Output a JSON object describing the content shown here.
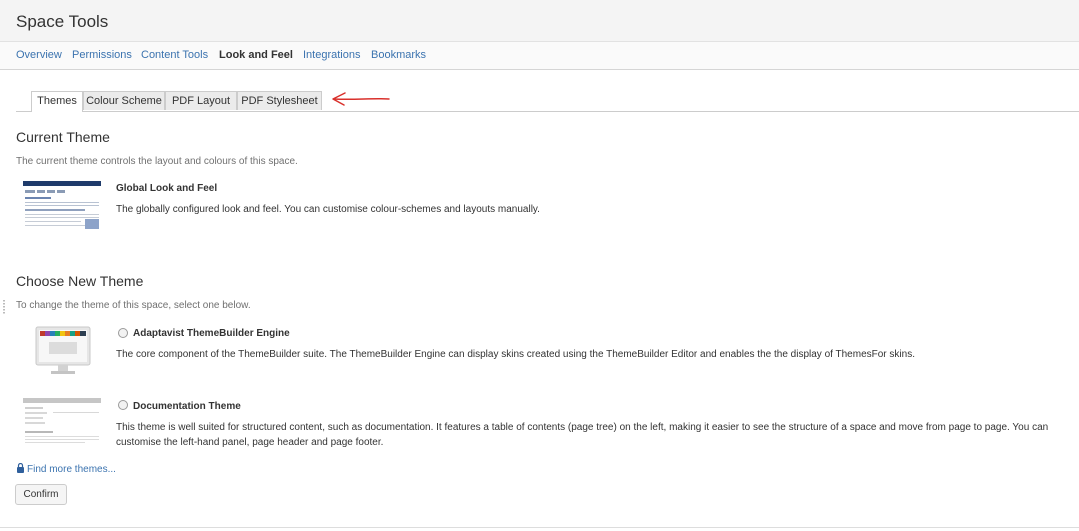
{
  "header": {
    "title": "Space Tools"
  },
  "nav": {
    "items": [
      {
        "label": "Overview"
      },
      {
        "label": "Permissions"
      },
      {
        "label": "Content Tools"
      },
      {
        "label": "Look and Feel",
        "active": true
      },
      {
        "label": "Integrations"
      },
      {
        "label": "Bookmarks"
      }
    ]
  },
  "subtabs": [
    {
      "label": "Themes",
      "active": true
    },
    {
      "label": "Colour Scheme"
    },
    {
      "label": "PDF Layout"
    },
    {
      "label": "PDF Stylesheet"
    }
  ],
  "current": {
    "heading": "Current Theme",
    "description": "The current theme controls the layout and colours of this space.",
    "theme_name": "Global Look and Feel",
    "theme_desc": "The globally configured look and feel. You can customise colour-schemes and layouts manually."
  },
  "choose": {
    "heading": "Choose New Theme",
    "description": "To change the theme of this space, select one below.",
    "themes": [
      {
        "name": "Adaptavist ThemeBuilder Engine",
        "desc": "The core component of the ThemeBuilder suite. The ThemeBuilder Engine can display skins created using the ThemeBuilder Editor and enables the the display of ThemesFor skins."
      },
      {
        "name": "Documentation Theme",
        "desc": "This theme is well suited for structured content, such as documentation. It features a table of contents (page tree) on the left, making it easier to see the structure of a space and move from page to page. You can customise the left-hand panel, page header and page footer."
      }
    ]
  },
  "find_more": "Find more themes...",
  "confirm_label": "Confirm",
  "colors": {
    "link": "#3b73af",
    "annotation": "#d9302b",
    "thumb_header": "#1f3b6b"
  }
}
